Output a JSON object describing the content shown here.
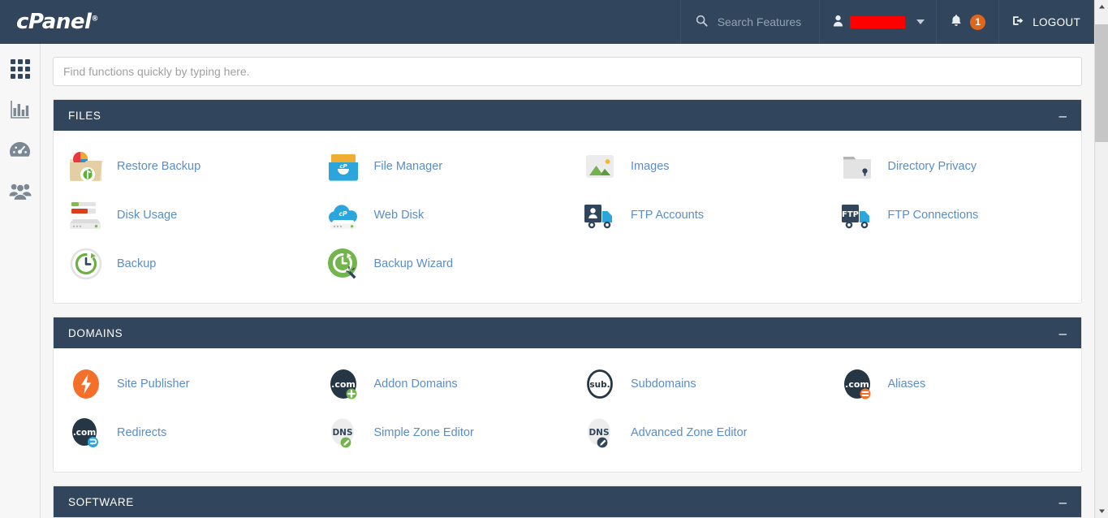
{
  "brand": {
    "name": "cPanel",
    "registered": "®"
  },
  "topnav": {
    "search_placeholder": "Search Features",
    "search_icon": "search-icon",
    "user_icon": "user-icon",
    "user_name_redacted": "",
    "notifications_icon": "bell-icon",
    "notifications_count": "1",
    "logout_label": "LOGOUT",
    "logout_icon": "logout-icon"
  },
  "sidebar": {
    "items": [
      {
        "name": "grid-icon",
        "label": "Home"
      },
      {
        "name": "bar-chart-icon",
        "label": "Statistics"
      },
      {
        "name": "gauge-icon",
        "label": "Dashboard"
      },
      {
        "name": "users-icon",
        "label": "User Manager"
      }
    ]
  },
  "quick_find": {
    "placeholder": "Find functions quickly by typing here.",
    "value": ""
  },
  "collapse_glyph": "–",
  "sections": [
    {
      "title": "FILES",
      "tiles": [
        {
          "label": "Restore Backup",
          "icon": "restore-backup-icon"
        },
        {
          "label": "File Manager",
          "icon": "file-manager-icon"
        },
        {
          "label": "Images",
          "icon": "images-icon"
        },
        {
          "label": "Directory Privacy",
          "icon": "directory-privacy-icon"
        },
        {
          "label": "Disk Usage",
          "icon": "disk-usage-icon"
        },
        {
          "label": "Web Disk",
          "icon": "web-disk-icon"
        },
        {
          "label": "FTP Accounts",
          "icon": "ftp-accounts-icon"
        },
        {
          "label": "FTP Connections",
          "icon": "ftp-connections-icon"
        },
        {
          "label": "Backup",
          "icon": "backup-icon"
        },
        {
          "label": "Backup Wizard",
          "icon": "backup-wizard-icon"
        }
      ]
    },
    {
      "title": "DOMAINS",
      "tiles": [
        {
          "label": "Site Publisher",
          "icon": "site-publisher-icon"
        },
        {
          "label": "Addon Domains",
          "icon": "addon-domains-icon"
        },
        {
          "label": "Subdomains",
          "icon": "subdomains-icon"
        },
        {
          "label": "Aliases",
          "icon": "aliases-icon"
        },
        {
          "label": "Redirects",
          "icon": "redirects-icon"
        },
        {
          "label": "Simple Zone Editor",
          "icon": "simple-zone-editor-icon"
        },
        {
          "label": "Advanced Zone Editor",
          "icon": "advanced-zone-editor-icon"
        }
      ]
    },
    {
      "title": "SOFTWARE",
      "tiles": []
    }
  ],
  "colors": {
    "header_navy": "#31465c",
    "link_blue": "#5a8dc8",
    "accent_orange": "#e0661b",
    "green": "#72b54c",
    "cpanel_blue": "#2ba6dd",
    "redaction_red": "#fe0000"
  }
}
